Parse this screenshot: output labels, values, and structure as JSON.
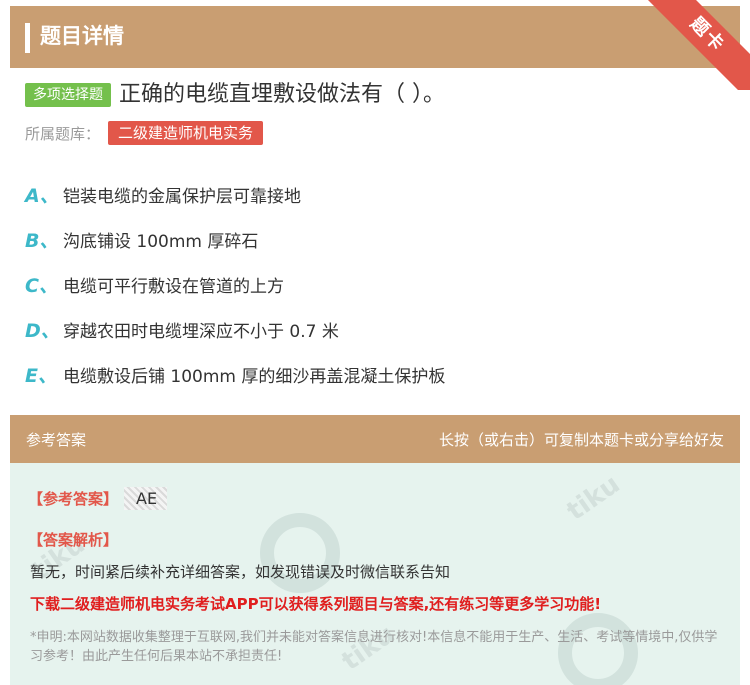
{
  "header": {
    "title": "题目详情",
    "ribbon": "题卡"
  },
  "question": {
    "type": "多项选择题",
    "text": "正确的电缆直埋敷设做法有（   ）。",
    "source_label": "所属题库：",
    "source": "二级建造师机电实务"
  },
  "options": [
    {
      "letter": "A、",
      "text": "铠装电缆的金属保护层可靠接地"
    },
    {
      "letter": "B、",
      "text": "沟底铺设 100mm 厚碎石"
    },
    {
      "letter": "C、",
      "text": "电缆可平行敷设在管道的上方"
    },
    {
      "letter": "D、",
      "text": "穿越农田时电缆埋深应不小于 0.7 米"
    },
    {
      "letter": "E、",
      "text": "电缆敷设后铺 100mm 厚的细沙再盖混凝土保护板"
    }
  ],
  "answer_section": {
    "title": "参考答案",
    "hint": "长按（或右击）可复制本题卡或分享给好友",
    "answer_label": "【参考答案】",
    "answer_value": "AE",
    "analysis_label": "【答案解析】",
    "analysis_text": "暂无，时间紧后续补充详细答案，如发现错误及时微信联系告知",
    "promo": "下载二级建造师机电实务考试APP可以获得系列题目与答案,还有练习等更多学习功能!",
    "notice": "*申明:本网站数据收集整理于互联网,我们并未能对答案信息进行核对!本信息不能用于生产、生活、考试等情境中,仅供学习参考！由此产生任何后果本站不承担责任!"
  },
  "watermark": "tiku"
}
